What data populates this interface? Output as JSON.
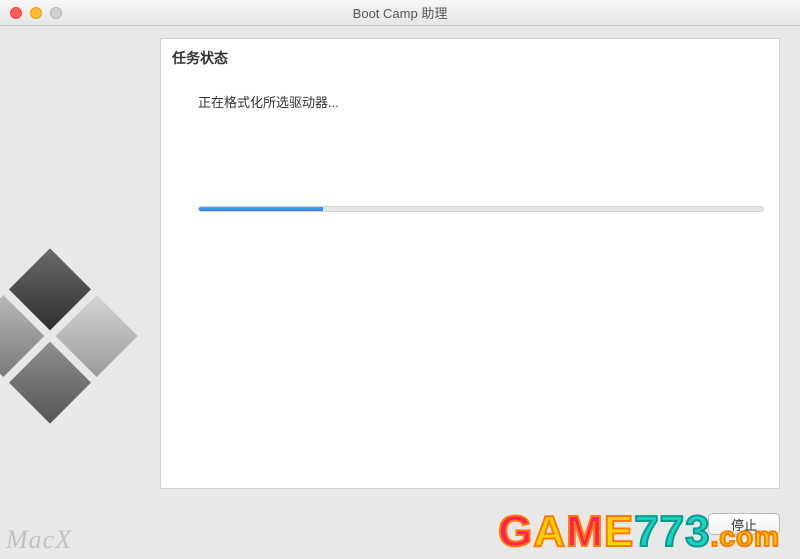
{
  "window": {
    "title": "Boot Camp 助理"
  },
  "heading": "任务状态",
  "status_text": "正在格式化所选驱动器...",
  "progress_percent": 22,
  "buttons": {
    "stop": "停止"
  },
  "watermarks": {
    "left": "MacX",
    "right": "GAME773.com"
  },
  "colors": {
    "progress": "#3a8ee6"
  }
}
